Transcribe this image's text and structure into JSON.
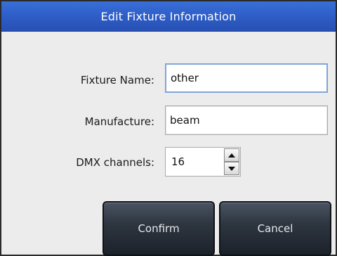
{
  "dialog": {
    "title": "Edit Fixture Information"
  },
  "form": {
    "fixture_name_label": "Fixture Name:",
    "fixture_name_value": "other",
    "manufacture_label": "Manufacture:",
    "manufacture_value": "beam",
    "dmx_channels_label": "DMX channels:",
    "dmx_channels_value": "16"
  },
  "buttons": {
    "confirm_label": "Confirm",
    "cancel_label": "Cancel"
  },
  "icons": {
    "spin_up": "triangle-up-icon",
    "spin_down": "triangle-down-icon"
  },
  "colors": {
    "titlebar": "#2f5fc8",
    "button": "#2e3641",
    "focus_border": "#7fa6d6"
  }
}
